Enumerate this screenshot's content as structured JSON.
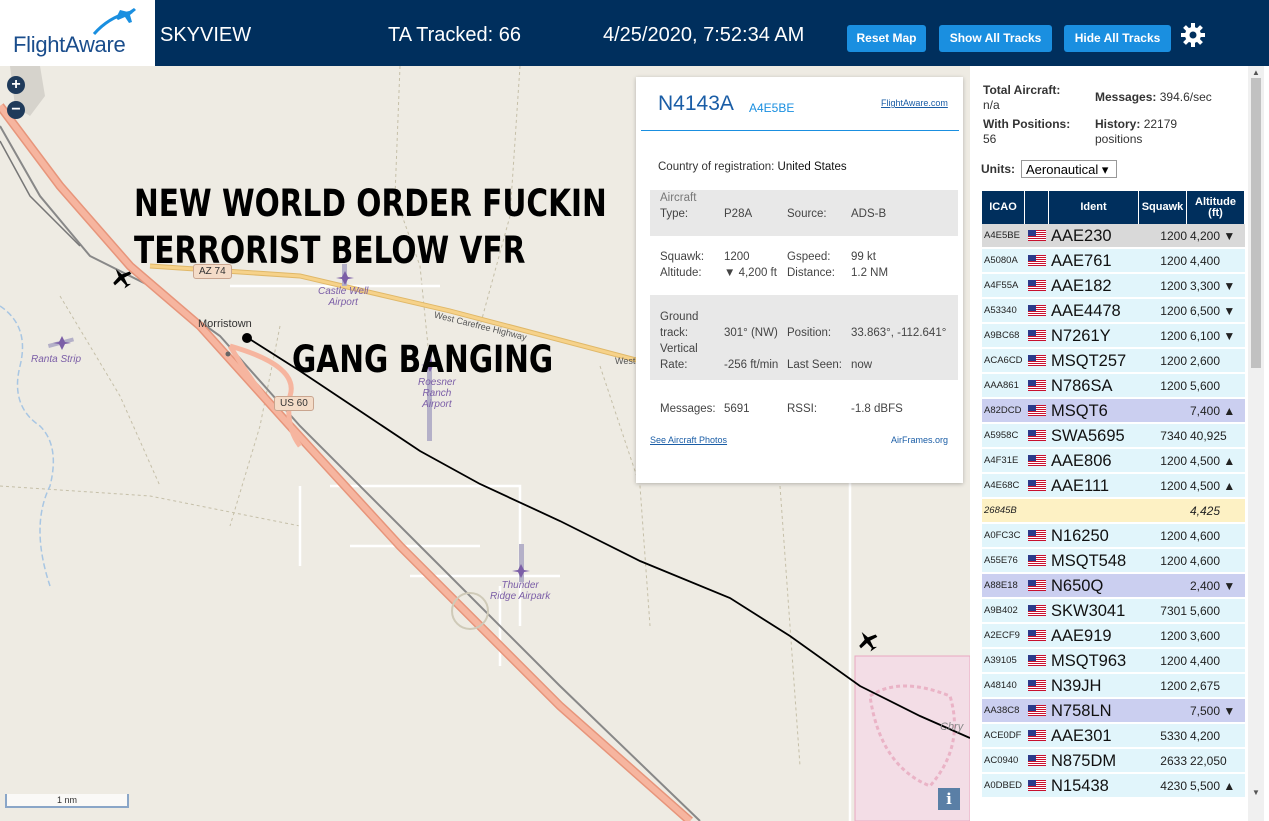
{
  "header": {
    "logo": "FlightAware",
    "title": "SKYVIEW",
    "tracked": "TA Tracked: 66",
    "datetime": "4/25/2020, 7:52:34 AM",
    "buttons": {
      "reset": "Reset Map",
      "show": "Show All Tracks",
      "hide": "Hide All Tracks"
    }
  },
  "map": {
    "overlay": [
      "NEW WORLD ORDER FUCKIN",
      "TERRORIST BELOW VFR",
      "GANG BANGING"
    ],
    "places": {
      "castle_well": "Castle Well\nAirport",
      "ranta": "Ranta Strip",
      "roesner": "Roesner\nRanch\nAirport",
      "thunder": "Thunder\nRidge Airpark",
      "morristown": "Morristown",
      "chry": "Chry",
      "highway": "West Carefree Highway",
      "west": "West"
    },
    "shields": {
      "az74": "AZ 74",
      "us60": "US 60"
    },
    "scale": "1 nm",
    "info": "i",
    "zoom_in": "+",
    "zoom_out": "−"
  },
  "popup": {
    "registration": "N4143A",
    "hex": "A4E5BE",
    "flightaware_link": "FlightAware.com",
    "country_label": "Country of registration:",
    "country": "United States",
    "aircraft_label": "Aircraft",
    "type_label": "Type:",
    "type": "P28A",
    "source_label": "Source:",
    "source": "ADS-B",
    "squawk_label": "Squawk:",
    "squawk": "1200",
    "gspeed_label": "Gspeed:",
    "gspeed": "99 kt",
    "altitude_label": "Altitude:",
    "altitude": "▼ 4,200 ft",
    "distance_label": "Distance:",
    "distance": "1.2 NM",
    "ground_label": "Ground",
    "track_label": "track:",
    "track": "301° (NW)",
    "position_label": "Position:",
    "position": "33.863°, -112.641°",
    "vertical_label": "Vertical",
    "rate_label": "Rate:",
    "rate": "-256 ft/min",
    "seen_label": "Last Seen:",
    "seen": "now",
    "messages_label": "Messages:",
    "messages": "5691",
    "rssi_label": "RSSI:",
    "rssi": "-1.8 dBFS",
    "photos_link": "See Aircraft Photos",
    "airframes_link": "AirFrames.org"
  },
  "sidebar": {
    "total_label": "Total Aircraft:",
    "total": "n/a",
    "messages_label": "Messages:",
    "messages": "394.6/sec",
    "positions_label": "With Positions:",
    "positions": "56",
    "history_label": "History:",
    "history": "22179",
    "history_unit": "positions",
    "units_label": "Units:",
    "units_value": "Aeronautical ▾",
    "columns": {
      "icao": "ICAO",
      "ident": "Ident",
      "squawk": "Squawk",
      "altitude": "Altitude\n(ft)"
    },
    "rows": [
      {
        "icao": "A4E5BE",
        "ident": "AAE230",
        "squawk": "1200",
        "alt": "4,200 ▼",
        "flag": true,
        "bg": "#d9d9d9"
      },
      {
        "icao": "A5080A",
        "ident": "AAE761",
        "squawk": "1200",
        "alt": "4,400",
        "flag": true,
        "bg": "#e1f5fb"
      },
      {
        "icao": "A4F55A",
        "ident": "AAE182",
        "squawk": "1200",
        "alt": "3,300 ▼",
        "flag": true,
        "bg": "#e1f5fb"
      },
      {
        "icao": "A53340",
        "ident": "AAE4478",
        "squawk": "1200",
        "alt": "6,500 ▼",
        "flag": true,
        "bg": "#e1f5fb"
      },
      {
        "icao": "A9BC68",
        "ident": "N7261Y",
        "squawk": "1200",
        "alt": "6,100 ▼",
        "flag": true,
        "bg": "#e1f5fb"
      },
      {
        "icao": "ACA6CD",
        "ident": "MSQT257",
        "squawk": "1200",
        "alt": "2,600",
        "flag": true,
        "bg": "#e1f5fb"
      },
      {
        "icao": "AAA861",
        "ident": "N786SA",
        "squawk": "1200",
        "alt": "5,600",
        "flag": true,
        "bg": "#e1f5fb"
      },
      {
        "icao": "A82DCD",
        "ident": "MSQT6",
        "squawk": "",
        "alt": "7,400 ▲",
        "flag": true,
        "bg": "#cbcff0"
      },
      {
        "icao": "A5958C",
        "ident": "SWA5695",
        "squawk": "7340",
        "alt": "40,925",
        "flag": true,
        "bg": "#e1f5fb"
      },
      {
        "icao": "A4F31E",
        "ident": "AAE806",
        "squawk": "1200",
        "alt": "4,500 ▲",
        "flag": true,
        "bg": "#e1f5fb"
      },
      {
        "icao": "A4E68C",
        "ident": "AAE111",
        "squawk": "1200",
        "alt": "4,500 ▲",
        "flag": true,
        "bg": "#e1f5fb"
      },
      {
        "icao": "26845B",
        "ident": "",
        "squawk": "",
        "alt": "4,425",
        "flag": false,
        "bg": "#fdf1c4",
        "italic": true
      },
      {
        "icao": "A0FC3C",
        "ident": "N16250",
        "squawk": "1200",
        "alt": "4,600",
        "flag": true,
        "bg": "#e1f5fb"
      },
      {
        "icao": "A55E76",
        "ident": "MSQT548",
        "squawk": "1200",
        "alt": "4,600",
        "flag": true,
        "bg": "#e1f5fb"
      },
      {
        "icao": "A88E18",
        "ident": "N650Q",
        "squawk": "",
        "alt": "2,400 ▼",
        "flag": true,
        "bg": "#cbcff0"
      },
      {
        "icao": "A9B402",
        "ident": "SKW3041",
        "squawk": "7301",
        "alt": "5,600",
        "flag": true,
        "bg": "#e1f5fb"
      },
      {
        "icao": "A2ECF9",
        "ident": "AAE919",
        "squawk": "1200",
        "alt": "3,600",
        "flag": true,
        "bg": "#e1f5fb"
      },
      {
        "icao": "A39105",
        "ident": "MSQT963",
        "squawk": "1200",
        "alt": "4,400",
        "flag": true,
        "bg": "#e1f5fb"
      },
      {
        "icao": "A48140",
        "ident": "N39JH",
        "squawk": "1200",
        "alt": "2,675",
        "flag": true,
        "bg": "#e1f5fb"
      },
      {
        "icao": "AA38C8",
        "ident": "N758LN",
        "squawk": "",
        "alt": "7,500 ▼",
        "flag": true,
        "bg": "#cbcff0"
      },
      {
        "icao": "ACE0DF",
        "ident": "AAE301",
        "squawk": "5330",
        "alt": "4,200",
        "flag": true,
        "bg": "#e1f5fb"
      },
      {
        "icao": "AC0940",
        "ident": "N875DM",
        "squawk": "2633",
        "alt": "22,050",
        "flag": true,
        "bg": "#e1f5fb"
      },
      {
        "icao": "A0DBED",
        "ident": "N15438",
        "squawk": "4230",
        "alt": "5,500 ▲",
        "flag": true,
        "bg": "#e1f5fb"
      }
    ]
  },
  "colors": {
    "header_bg": "#002f5d",
    "button": "#1a8fe0",
    "track": "#000000",
    "highway": "#f2a387",
    "road": "#f6d28a"
  },
  "icons": [
    "plus-icon",
    "minus-icon",
    "gear-icon",
    "info-icon",
    "flag-icon",
    "airport-icon",
    "aircraft-icon"
  ]
}
